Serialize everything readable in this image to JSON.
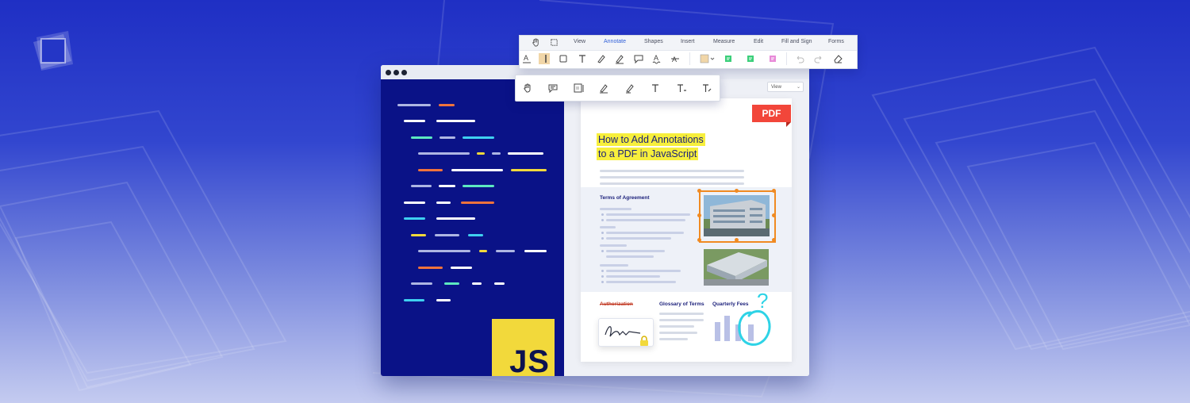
{
  "toolbar": {
    "tabs": [
      "View",
      "Annotate",
      "Shapes",
      "Insert",
      "Measure",
      "Edit",
      "Fill and Sign",
      "Forms"
    ],
    "active_tab": "Annotate",
    "icons": [
      "pan-icon",
      "select-icon",
      "underline-text-icon",
      "highlight-icon",
      "rectangle-icon",
      "text-icon",
      "free-hand-icon",
      "free-highlight-icon",
      "comment-icon",
      "squiggly-text-icon",
      "strikeout-text-icon",
      "color-swatch-icon",
      "sticky-note-green-icon",
      "sticky-note-green-2-icon",
      "sticky-note-pink-icon",
      "undo-icon",
      "redo-icon",
      "eraser-icon"
    ]
  },
  "subtoolbar": {
    "icons": [
      "pan-icon",
      "comment-icon",
      "note-icon",
      "pen-icon",
      "highlighter-icon",
      "free-text-icon",
      "text-subscript-icon",
      "text-edit-icon"
    ]
  },
  "viewer": {
    "view_select": "View"
  },
  "document": {
    "badge": "PDF",
    "title_line1": "How to Add Annotations",
    "title_line2": "to a PDF in JavaScript",
    "section_title": "Terms of Agreement",
    "authorization": "Authorization",
    "glossary": "Glossary of Terms",
    "fees": "Quarterly Fees",
    "question_mark": "?"
  },
  "editor": {
    "badge": "JS"
  },
  "colors": {
    "accent_orange": "#f08a22",
    "highlight_yellow": "#f7ef3c",
    "pdf_red": "#f2463a",
    "code_bg": "#0a1287",
    "js_yellow": "#f2d93b",
    "cyan_circle": "#2ed3e6"
  }
}
